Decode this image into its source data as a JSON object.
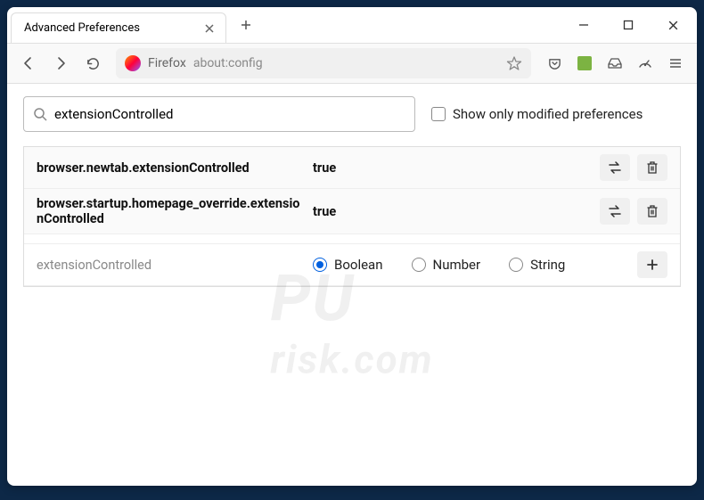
{
  "tab": {
    "title": "Advanced Preferences"
  },
  "urlbar": {
    "brand": "Firefox",
    "address": "about:config"
  },
  "search": {
    "value": "extensionControlled",
    "checkbox_label": "Show only modified preferences"
  },
  "prefs": [
    {
      "name": "browser.newtab.extensionControlled",
      "value": "true"
    },
    {
      "name": "browser.startup.homepage_override.extensionControlled",
      "value": "true"
    }
  ],
  "addrow": {
    "name": "extensionControlled",
    "types": [
      "Boolean",
      "Number",
      "String"
    ]
  },
  "watermark": {
    "line1": "PU",
    "line2": "risk.com"
  }
}
